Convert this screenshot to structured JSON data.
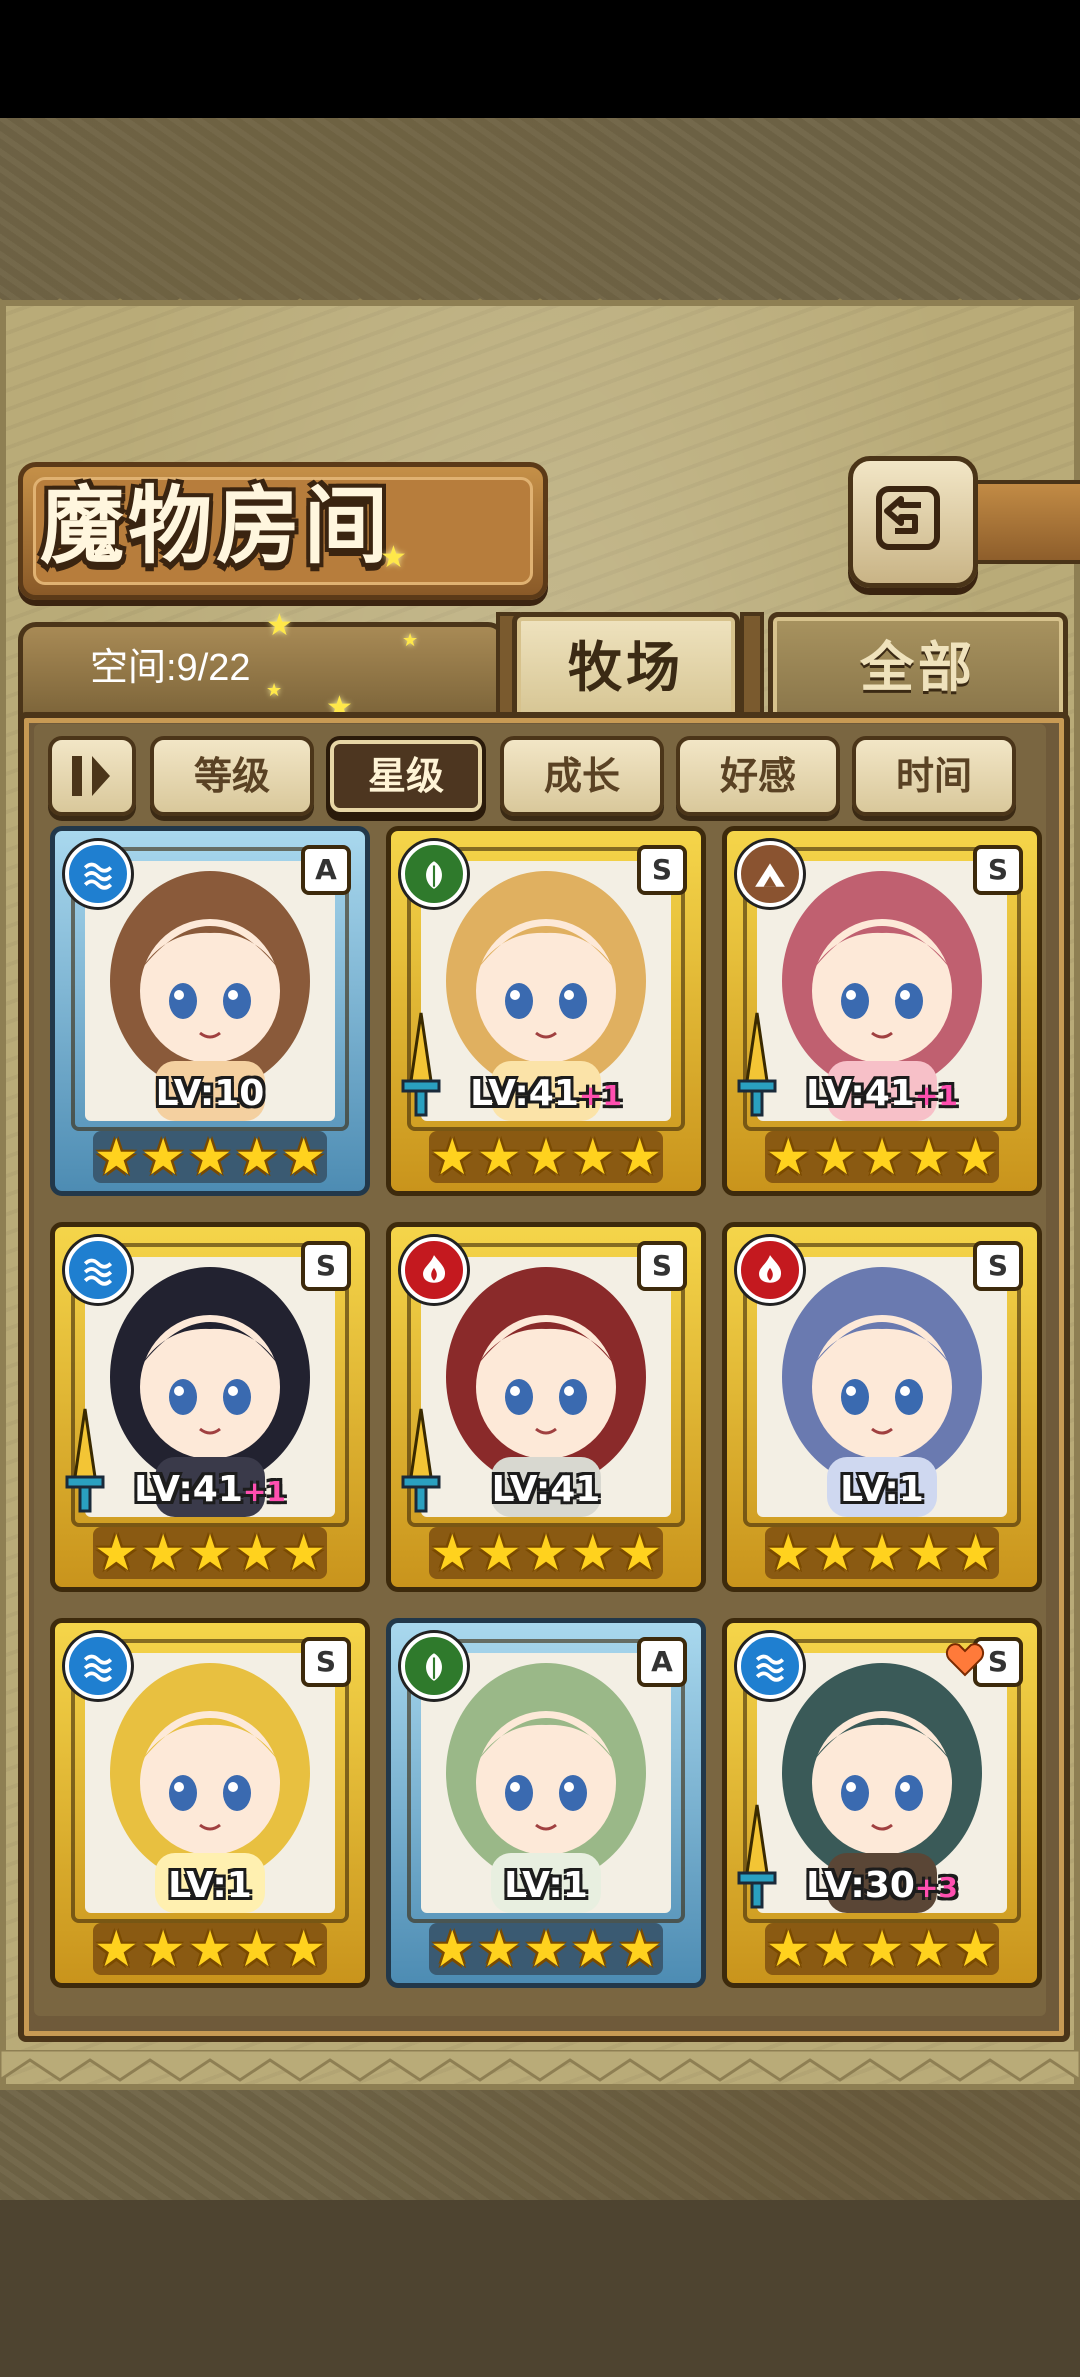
{
  "screen": {
    "title": "魔物房间",
    "space_label": "空间:9/22",
    "tabs": [
      {
        "label": "牧场",
        "active": true
      },
      {
        "label": "全部",
        "active": false
      }
    ],
    "sort_buttons": [
      {
        "label": "等级",
        "active": false
      },
      {
        "label": "星级",
        "active": true
      },
      {
        "label": "成长",
        "active": false
      },
      {
        "label": "好感",
        "active": false
      },
      {
        "label": "时间",
        "active": false
      }
    ]
  },
  "monsters": [
    {
      "level": "LV:10",
      "bonus": "",
      "rarity": "A",
      "element": "water-icon",
      "stars": 5,
      "frame": "blue",
      "weapon": false
    },
    {
      "level": "LV:41",
      "bonus": "+1",
      "rarity": "S",
      "element": "leaf-icon",
      "stars": 5,
      "frame": "gold",
      "weapon": true
    },
    {
      "level": "LV:41",
      "bonus": "+1",
      "rarity": "S",
      "element": "mountain-icon",
      "stars": 5,
      "frame": "gold",
      "weapon": true
    },
    {
      "level": "LV:41",
      "bonus": "+1",
      "rarity": "S",
      "element": "water-icon",
      "stars": 5,
      "frame": "gold",
      "weapon": true
    },
    {
      "level": "LV:41",
      "bonus": "",
      "rarity": "S",
      "element": "fire-icon",
      "stars": 5,
      "frame": "gold",
      "weapon": true
    },
    {
      "level": "LV:1",
      "bonus": "",
      "rarity": "S",
      "element": "fire-icon",
      "stars": 5,
      "frame": "gold",
      "weapon": false
    },
    {
      "level": "LV:1",
      "bonus": "",
      "rarity": "S",
      "element": "water-icon",
      "stars": 5,
      "frame": "gold",
      "weapon": false
    },
    {
      "level": "LV:1",
      "bonus": "",
      "rarity": "A",
      "element": "leaf-icon",
      "stars": 5,
      "frame": "blue",
      "weapon": false
    },
    {
      "level": "LV:30",
      "bonus": "+3",
      "rarity": "S",
      "element": "water-icon",
      "stars": 5,
      "frame": "gold",
      "weapon": true
    }
  ]
}
